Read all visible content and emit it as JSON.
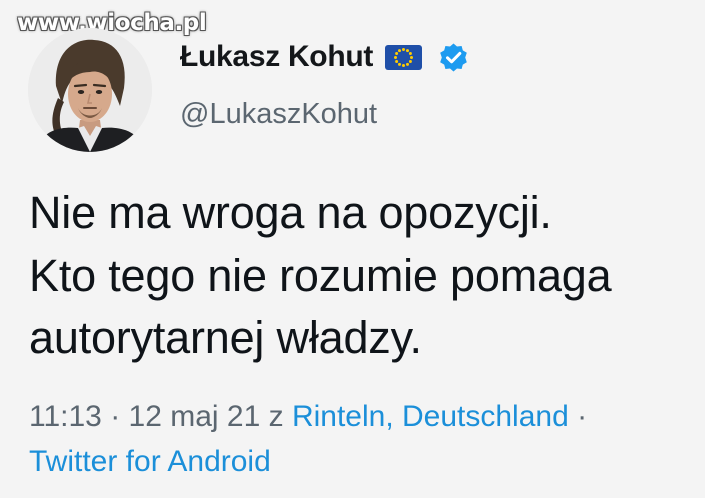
{
  "watermark": {
    "text": "www.wiocha.pl"
  },
  "author": {
    "display_name": "Łukasz Kohut",
    "handle": "@LukaszKohut",
    "badges": [
      "eu-flag-icon",
      "verified-badge-icon"
    ]
  },
  "tweet": {
    "lines": [
      "Nie ma wroga na opozycji.",
      "Kto tego nie rozumie pomaga",
      "autorytarnej władzy."
    ]
  },
  "meta": {
    "time": "11:13",
    "separator": " · ",
    "date": "12 maj 21",
    "location_prefix": " z ",
    "location": "Rinteln, Deutschland",
    "trailing_separator": " ·",
    "source": "Twitter for Android"
  },
  "colors": {
    "background": "#f4f4f4",
    "text": "#0f1419",
    "secondary": "#5b6670",
    "link": "#1b8fd9",
    "verified": "#1d9bf0",
    "eu_blue": "#1f4fa8",
    "eu_star": "#ffcc00"
  }
}
